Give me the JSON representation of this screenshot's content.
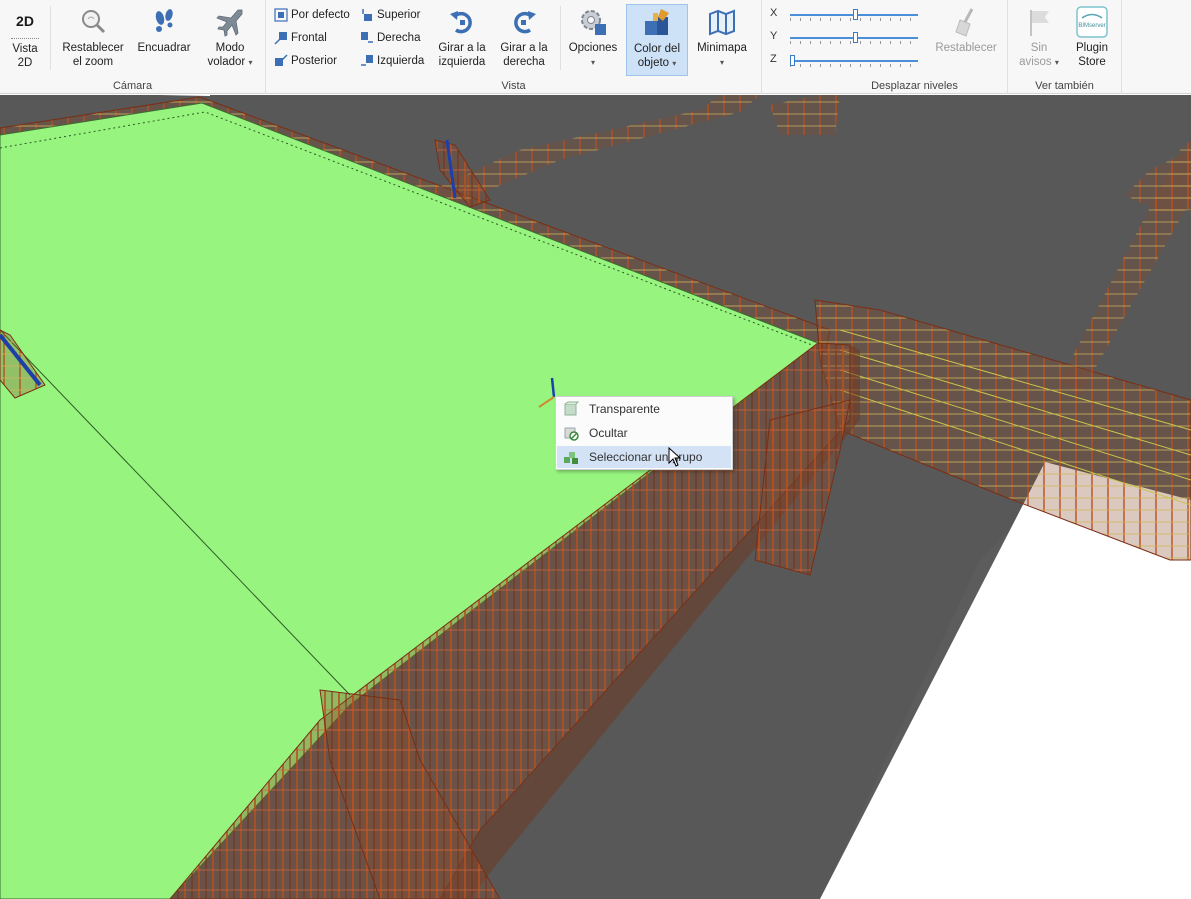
{
  "ribbon": {
    "camera": {
      "group_label": "Cámara",
      "vista2d_icon_text": "2D",
      "vista2d_label_1": "Vista",
      "vista2d_label_2": "2D",
      "reset_zoom_label_1": "Restablecer",
      "reset_zoom_label_2": "el zoom",
      "fit_label": "Encuadrar",
      "fly_label_1": "Modo",
      "fly_label_2": "volador"
    },
    "view": {
      "group_label": "Vista",
      "default_label": "Por defecto",
      "front_label": "Frontal",
      "back_label": "Posterior",
      "top_label": "Superior",
      "right_label": "Derecha",
      "left_label": "Izquierda",
      "rotate_left_label_1": "Girar a la",
      "rotate_left_label_2": "izquierda",
      "rotate_right_label_1": "Girar a la",
      "rotate_right_label_2": "derecha",
      "options_label": "Opciones",
      "object_color_label_1": "Color del",
      "object_color_label_2": "objeto",
      "minimap_label": "Minimapa"
    },
    "levels": {
      "group_label": "Desplazar niveles",
      "x_label": "X",
      "y_label": "Y",
      "z_label": "Z",
      "x_value": 0.5,
      "y_value": 0.5,
      "z_value": 0.0,
      "reset_label": "Restablecer"
    },
    "see_also": {
      "group_label": "Ver también",
      "no_warnings_label_1": "Sin",
      "no_warnings_label_2": "avisos",
      "plugin_label_1": "Plugin",
      "plugin_label_2": "Store",
      "plugin_logo_text": "BIMserver"
    }
  },
  "context_menu": {
    "items": [
      {
        "label": "Transparente",
        "icon": "transparent-cube-icon"
      },
      {
        "label": "Ocultar",
        "icon": "hide-icon"
      },
      {
        "label": "Seleccionar un grupo",
        "icon": "select-group-icon"
      }
    ]
  },
  "colors": {
    "slab_green": "#96f47f",
    "ground_gray": "#5a5a5a",
    "rebar_orange": "#b5501f",
    "active_blue": "#cde1f7",
    "slider_blue": "#4a8fd8"
  }
}
